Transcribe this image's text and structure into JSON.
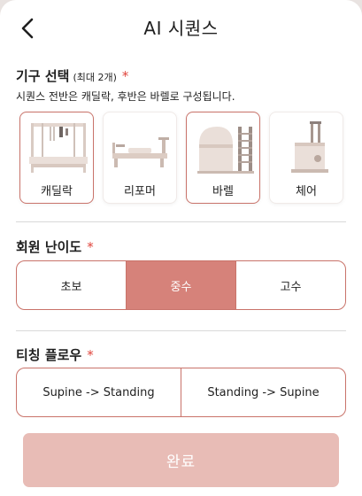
{
  "header": {
    "title": "AI 시퀀스",
    "back_icon": "chevron-left-icon"
  },
  "equipment": {
    "title": "기구 선택",
    "limit_note": "(최대 2개)",
    "required_mark": "*",
    "description": "시퀀스 전반은 캐딜락, 후반은 바렐로 구성됩니다.",
    "items": [
      {
        "label": "캐딜락",
        "icon": "cadillac-icon",
        "selected": true
      },
      {
        "label": "리포머",
        "icon": "reformer-icon",
        "selected": false
      },
      {
        "label": "바렐",
        "icon": "barrel-icon",
        "selected": true
      },
      {
        "label": "체어",
        "icon": "chair-icon",
        "selected": false
      }
    ]
  },
  "difficulty": {
    "title": "회원 난이도",
    "required_mark": "*",
    "options": [
      "초보",
      "중수",
      "고수"
    ],
    "selected": "중수"
  },
  "flow": {
    "title": "티칭 플로우",
    "required_mark": "*",
    "options": [
      "Supine -> Standing",
      "Standing -> Supine"
    ]
  },
  "footer": {
    "done_label": "완료"
  },
  "colors": {
    "accent": "#c9736a",
    "selected_fill": "#d6827a",
    "disabled_button": "#e8bcb6",
    "required": "#e0443b"
  }
}
